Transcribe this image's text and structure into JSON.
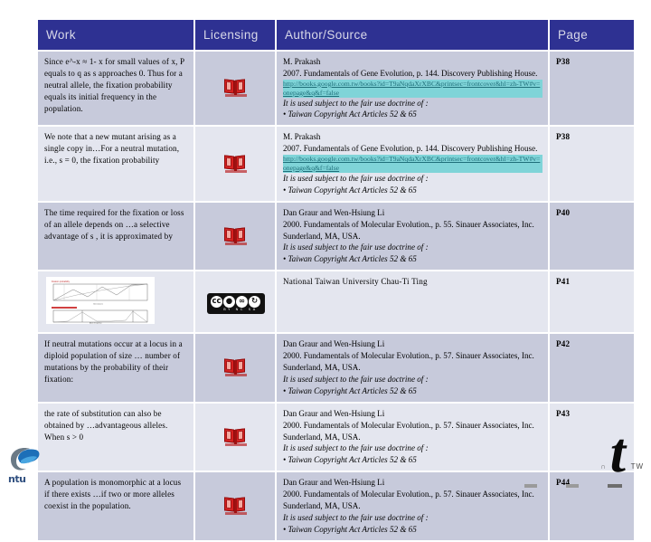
{
  "table": {
    "headers": [
      "Work",
      "Licensing",
      "Author/Source",
      "Page"
    ],
    "rows": [
      {
        "work": "Since e^-x ≈ 1- x for small values of x, P equals to q as s approaches 0.  Thus for a neutral allele, the fixation probability equals its initial frequency in the population.",
        "licensing_icon": "book-icon",
        "author_lines": [
          "M. Prakash",
          "2007. Fundamentals of Gene Evolution, p. 144. Discovery Publishing House."
        ],
        "author_link": "http://books.google.com.tw/books?id=T9aNqdaXrXBC&printsec=frontcover&hl=zh-TW#v=onepage&q&f=false",
        "fairuse_lead": "It is used subject to the fair use doctrine of :",
        "fairuse_item": "• Taiwan Copyright Act Articles 52 & 65",
        "page": "P38"
      },
      {
        "work": "We note that a new mutant arising as a single copy in…For a neutral mutation, i.e., s = 0, the fixation probability",
        "licensing_icon": "book-icon",
        "author_lines": [
          "M. Prakash",
          "2007. Fundamentals of Gene Evolution, p. 144. Discovery Publishing House."
        ],
        "author_link": "http://books.google.com.tw/books?id=T9aNqdaXrXBC&printsec=frontcover&hl=zh-TW#v=onepage&q&f=false",
        "fairuse_lead": "It is used subject to the fair use doctrine of :",
        "fairuse_item": "• Taiwan Copyright Act Articles 52 & 65",
        "page": "P38"
      },
      {
        "work": "The time required for the fixation or loss of an allele depends on …a selective advantage of s , it is approximated by",
        "licensing_icon": "book-icon",
        "author_lines": [
          "Dan Graur and Wen-Hsiung Li",
          "2000. Fundamentals of Molecular Evolution., p. 55. Sinauer Associates, Inc.",
          "Sunderland, MA, USA."
        ],
        "author_link": "",
        "fairuse_lead": "It is used subject to the fair use doctrine of :",
        "fairuse_item": "• Taiwan Copyright Act Articles 52 & 65",
        "page": "P40"
      },
      {
        "work": "",
        "work_thumbnail": "chart-thumbnail",
        "licensing_icon": "cc-by-nc-sa-badge",
        "cc_author": "National Taiwan University Chau-Ti Ting",
        "author_lines": [],
        "author_link": "",
        "fairuse_lead": "",
        "fairuse_item": "",
        "page": "P41"
      },
      {
        "work": "If neutral mutations occur at a locus in a diploid population of size … number of mutations by the probability of their fixation:",
        "licensing_icon": "book-icon",
        "author_lines": [
          "Dan Graur and Wen-Hsiung Li",
          "2000. Fundamentals of Molecular Evolution., p. 57. Sinauer Associates, Inc.",
          "Sunderland, MA, USA."
        ],
        "author_link": "",
        "fairuse_lead": "It is used subject to the fair use doctrine of :",
        "fairuse_item": "• Taiwan Copyright Act Articles 52 & 65",
        "page": "P42"
      },
      {
        "work": "the rate of substitution can also be obtained by …advantageous alleles. When s > 0",
        "licensing_icon": "book-icon",
        "author_lines": [
          "Dan Graur and Wen-Hsiung Li",
          "2000. Fundamentals of Molecular Evolution., p. 57. Sinauer Associates, Inc.",
          "Sunderland, MA, USA."
        ],
        "author_link": "",
        "fairuse_lead": "It is used subject to the fair use doctrine of :",
        "fairuse_item": "• Taiwan Copyright Act Articles 52 & 65",
        "page": "P43"
      },
      {
        "work": "A population is monomorphic at a locus if there exists …if two or more alleles coexist in the population.",
        "licensing_icon": "book-icon",
        "author_lines": [
          "Dan Graur and Wen-Hsiung Li",
          "2000. Fundamentals of Molecular Evolution., p. 57. Sinauer Associates, Inc.",
          "Sunderland, MA, USA."
        ],
        "author_link": "",
        "fairuse_lead": "It is used subject to the fair use doctrine of :",
        "fairuse_item": "• Taiwan Copyright Act Articles 52 & 65",
        "page": "P44"
      }
    ]
  },
  "cc_badge": {
    "symbols": [
      "cc",
      "BY",
      "NC",
      "SA"
    ],
    "caption": "BY  NC  SA"
  },
  "logo": {
    "text": "ntu"
  },
  "corner": {
    "mark": "t",
    "region": "TW",
    "dots": "∩"
  },
  "colors": {
    "header_bg": "#2e3192",
    "header_text": "#d8d8e8",
    "row_odd": "#c7cadb",
    "row_even": "#e4e6ef",
    "link_text": "#1f6f7a",
    "link_highlight": "#7fd4d8",
    "book_red": "#d82020"
  }
}
